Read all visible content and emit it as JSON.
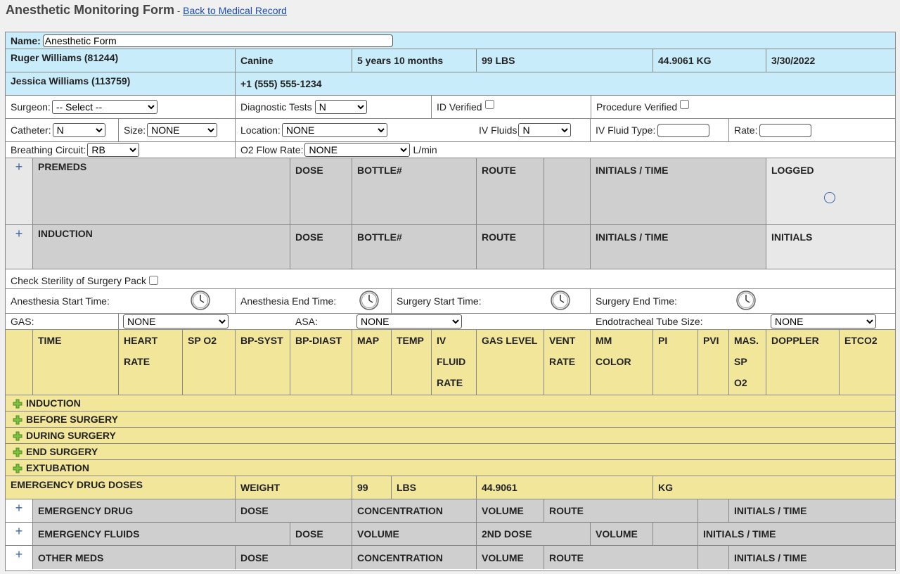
{
  "header": {
    "title": "Anesthetic Monitoring Form",
    "separator": "-",
    "back_link": "Back to Medical Record"
  },
  "patient": {
    "name_label": "Name:",
    "name_value": "Anesthetic Form",
    "pet": "Ruger Williams (81244)",
    "species": "Canine",
    "age": "5 years 10 months",
    "weight_lbs": "99 LBS",
    "weight_kg": "44.9061 KG",
    "date": "3/30/2022",
    "owner": "Jessica Williams (113759)",
    "phone": "+1 (555) 555-1234"
  },
  "fields": {
    "surgeon_label": "Surgeon:",
    "surgeon_value": "-- Select --",
    "diag_label": "Diagnostic Tests",
    "diag_value": "N",
    "id_verified_label": "ID Verified",
    "procedure_verified_label": "Procedure Verified",
    "catheter_label": "Catheter:",
    "catheter_value": "N",
    "size_label": "Size:",
    "size_value": "NONE",
    "location_label": "Location:",
    "location_value": "NONE",
    "iv_fluids_label": "IV Fluids",
    "iv_fluids_value": "N",
    "iv_fluid_type_label": "IV Fluid Type:",
    "rate_label": "Rate:",
    "breathing_label": "Breathing Circuit:",
    "breathing_value": "RB",
    "o2_label": "O2 Flow Rate:",
    "o2_value": "NONE",
    "o2_unit": "L/min"
  },
  "premeds": {
    "title": "PREMEDS",
    "dose": "DOSE",
    "bottle": "BOTTLE#",
    "route": "ROUTE",
    "initials_time": "INITIALS / TIME",
    "logged": "LOGGED"
  },
  "induction": {
    "title": "INDUCTION",
    "dose": "DOSE",
    "bottle": "BOTTLE#",
    "route": "ROUTE",
    "initials_time": "INITIALS / TIME",
    "initials": "INITIALS"
  },
  "sterility_label": "Check Sterility of Surgery Pack",
  "times": {
    "anesthesia_start": "Anesthesia Start Time:",
    "anesthesia_end": "Anesthesia End Time:",
    "surgery_start": "Surgery Start Time:",
    "surgery_end": "Surgery End Time:"
  },
  "gas_row": {
    "gas_label": "GAS:",
    "gas_value": "NONE",
    "asa_label": "ASA:",
    "asa_value": "NONE",
    "et_label": "Endotracheal Tube Size:",
    "et_value": "NONE"
  },
  "vitals_headers": {
    "time": "TIME",
    "heart_rate": "HEART RATE",
    "sp_o2": "SP O2",
    "bp_syst": "BP-SYST",
    "bp_diast": "BP-DIAST",
    "map": "MAP",
    "temp": "TEMP",
    "iv_fluid_rate": "IV FLUID RATE",
    "gas_level": "GAS LEVEL",
    "vent_rate": "VENT RATE",
    "mm_color": "MM COLOR",
    "pi": "PI",
    "pvi": "PVI",
    "mas_sp_o2": "MAS. SP O2",
    "doppler": "DOPPLER",
    "etco2": "ETCO2"
  },
  "phases": [
    "INDUCTION",
    "BEFORE SURGERY",
    "DURING SURGERY",
    "END SURGERY",
    "EXTUBATION"
  ],
  "emergency_doses": {
    "title": "EMERGENCY DRUG DOSES",
    "weight_label": "WEIGHT",
    "weight_lbs": "99",
    "lbs": "LBS",
    "weight_kg": "44.9061",
    "kg": "KG"
  },
  "emergency_drug": {
    "title": "EMERGENCY DRUG",
    "dose": "DOSE",
    "concentration": "CONCENTRATION",
    "volume": "VOLUME",
    "route": "ROUTE",
    "initials_time": "INITIALS / TIME"
  },
  "emergency_fluids": {
    "title": "EMERGENCY FLUIDS",
    "dose": "DOSE",
    "volume": "VOLUME",
    "second_dose": "2ND DOSE",
    "volume2": "VOLUME",
    "initials_time": "INITIALS / TIME"
  },
  "other_meds": {
    "title": "OTHER MEDS",
    "dose": "DOSE",
    "concentration": "CONCENTRATION",
    "volume": "VOLUME",
    "route": "ROUTE",
    "initials_time": "INITIALS / TIME"
  },
  "icons": {
    "add": "plus-icon",
    "phase": "green-plus-icon",
    "clock": "clock-icon",
    "status": "circle-icon"
  }
}
